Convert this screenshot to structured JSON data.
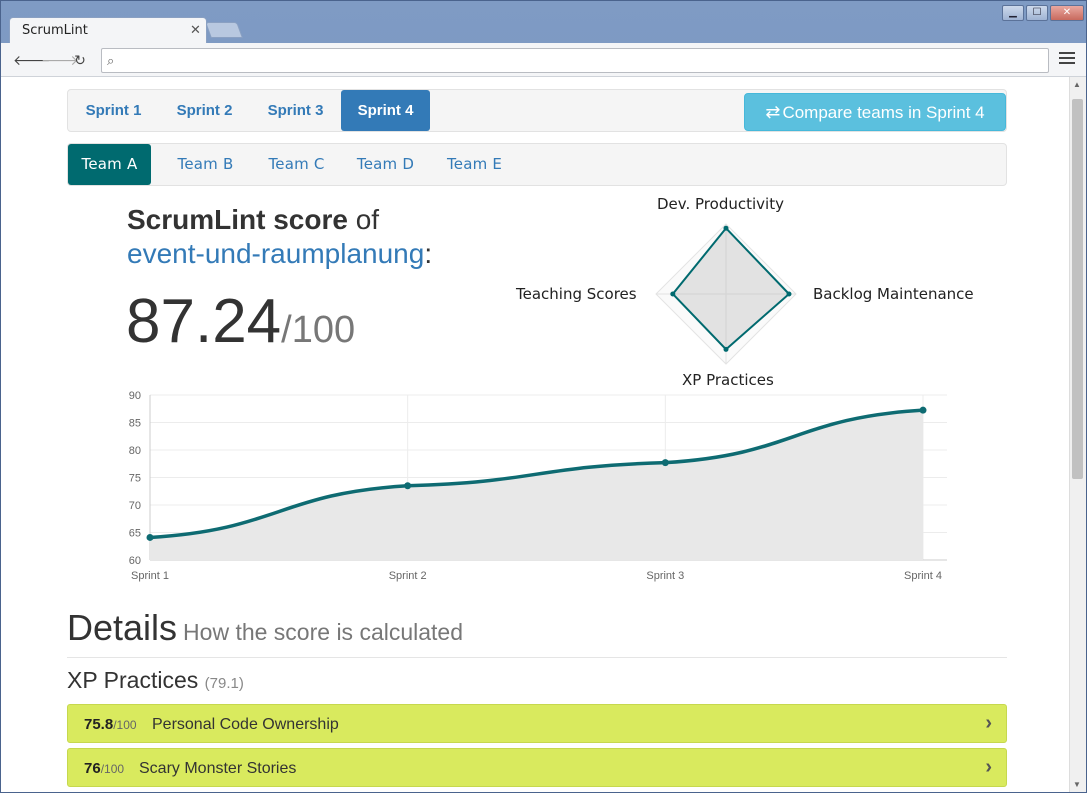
{
  "browser": {
    "tab_title": "ScrumLint",
    "tab_close": "✕",
    "address_value": "",
    "window_controls": {
      "minimize": "▁",
      "maximize": "☐",
      "close": "✕"
    }
  },
  "sprint_nav": {
    "items": [
      {
        "label": "Sprint 1",
        "active": false
      },
      {
        "label": "Sprint 2",
        "active": false
      },
      {
        "label": "Sprint 3",
        "active": false
      },
      {
        "label": "Sprint 4",
        "active": true
      }
    ],
    "compare_label": "Compare teams in Sprint 4"
  },
  "team_nav": {
    "items": [
      {
        "label": "Team A",
        "active": true
      },
      {
        "label": "Team B",
        "active": false
      },
      {
        "label": "Team C",
        "active": false
      },
      {
        "label": "Team D",
        "active": false
      },
      {
        "label": "Team E",
        "active": false
      }
    ]
  },
  "score": {
    "title_bold": "ScrumLint score",
    "title_of": " of",
    "repo_name": "event-und-raumplanung",
    "repo_suffix": ":",
    "value": "87.24",
    "max": "/100"
  },
  "radar": {
    "labels": {
      "top": "Dev. Productivity",
      "right": "Backlog Maintenance",
      "bottom": "XP Practices",
      "left": "Teaching Scores"
    },
    "values": {
      "top": 94,
      "right": 90,
      "bottom": 79.1,
      "left": 76
    },
    "max": 100,
    "color": "#006a6f"
  },
  "chart_data": {
    "type": "line",
    "categories": [
      "Sprint 1",
      "Sprint 2",
      "Sprint 3",
      "Sprint 4"
    ],
    "series": [
      {
        "values": [
          64.1,
          73.5,
          77.7,
          87.24
        ]
      }
    ],
    "ylim": [
      60,
      90
    ],
    "yticks": [
      60,
      65,
      70,
      75,
      80,
      85,
      90
    ],
    "grid": true,
    "line_color": "#0e6b72",
    "fill_color": "#e8e8e8"
  },
  "details": {
    "title": "Details",
    "subtitle": "How the score is calculated",
    "section_title": "XP Practices",
    "section_score": "(79.1)",
    "metrics": [
      {
        "score": "75.8",
        "max": "/100",
        "name": "Personal Code Ownership"
      },
      {
        "score": "76",
        "max": "/100",
        "name": "Scary Monster Stories"
      }
    ]
  },
  "colors": {
    "primary": "#337ab7",
    "team_active": "#006a6f",
    "info_button": "#5bc0de",
    "metric_row": "#d9ea5e"
  }
}
